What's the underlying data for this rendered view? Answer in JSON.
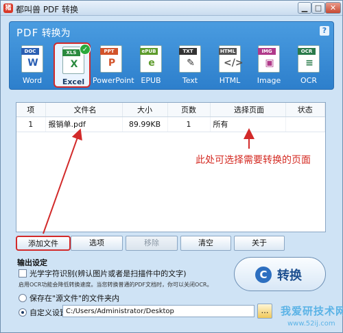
{
  "window": {
    "title": "都叫兽 PDF 转换"
  },
  "header": {
    "title_prefix": "PDF",
    "title_suffix": "转换为",
    "help_glyph": "?"
  },
  "formats": [
    {
      "tag": "DOC",
      "label": "Word",
      "color": "#2b5fb3",
      "mark": "W"
    },
    {
      "tag": "XLS",
      "label": "Excel",
      "color": "#2b8a3e",
      "mark": "X",
      "selected": true
    },
    {
      "tag": "PPT",
      "label": "PowerPoint",
      "color": "#d2532a",
      "mark": "P"
    },
    {
      "tag": "ePUB",
      "label": "EPUB",
      "color": "#5d9b2b",
      "mark": "e"
    },
    {
      "tag": "TXT",
      "label": "Text",
      "color": "#333333",
      "mark": "✎"
    },
    {
      "tag": "HTML",
      "label": "HTML",
      "color": "#555555",
      "mark": "</>"
    },
    {
      "tag": "IMG",
      "label": "Image",
      "color": "#b03a8a",
      "mark": "▣"
    },
    {
      "tag": "OCR",
      "label": "OCR",
      "color": "#2a7a4a",
      "mark": "≡"
    }
  ],
  "table": {
    "headers": [
      "项",
      "文件名",
      "大小",
      "页数",
      "选择页面",
      "状态"
    ],
    "rows": [
      {
        "idx": "1",
        "name": "报销单.pdf",
        "size": "89.99KB",
        "pages": "1",
        "range": "所有",
        "status": ""
      }
    ]
  },
  "annotation": "此处可选择需要转换的页面",
  "buttons": {
    "add_file": "添加文件",
    "options": "选项",
    "remove": "移除",
    "clear": "清空",
    "about": "关于"
  },
  "output": {
    "title": "输出设定",
    "ocr_label": "光学字符识别(辨认图片或者是扫描件中的文字)",
    "hint": "启用OCR功能会降低转换速度。当您转换普通的PDF文档时，你可以关闭OCR。",
    "save_source_label": "保存在\"源文件\"的文件夹内",
    "custom_label": "自定义设置",
    "path_value": "C:/Users/Administrator/Desktop",
    "browse_glyph": "…"
  },
  "convert": {
    "label": "转换",
    "icon_glyph": "C"
  },
  "watermark": {
    "main": "我爱研技术网",
    "sub": "www.52ij.com"
  },
  "colors": {
    "accent": "#2d7fcc",
    "highlight": "#d22a2a"
  }
}
